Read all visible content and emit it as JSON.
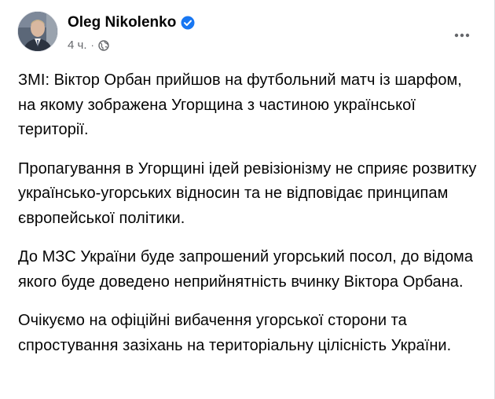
{
  "post": {
    "author": "Oleg Nikolenko",
    "timestamp": "4 ч.",
    "separator": "·",
    "verified_icon": "verified-badge-icon",
    "audience_icon": "globe-icon",
    "more_icon": "more-options-icon",
    "colors": {
      "verified": "#1877f2",
      "meta_text": "#65676b",
      "text": "#050505"
    },
    "paragraphs": [
      "ЗМІ: Віктор Орбан прийшов на футбольний матч із шарфом, на якому зображена Угорщина з частиною української території.",
      "Пропагування в Угорщині ідей ревізіонізму не сприяє розвитку українсько-угорських відносин та не відповідає принципам європейської політики.",
      "До МЗС України буде запрошений угорський посол, до відома якого буде доведено неприйнятність вчинку Віктора Орбана.",
      "Очікуємо на офіційні вибачення угорської сторони та спростування зазіхань на територіальну цілісність України."
    ]
  }
}
